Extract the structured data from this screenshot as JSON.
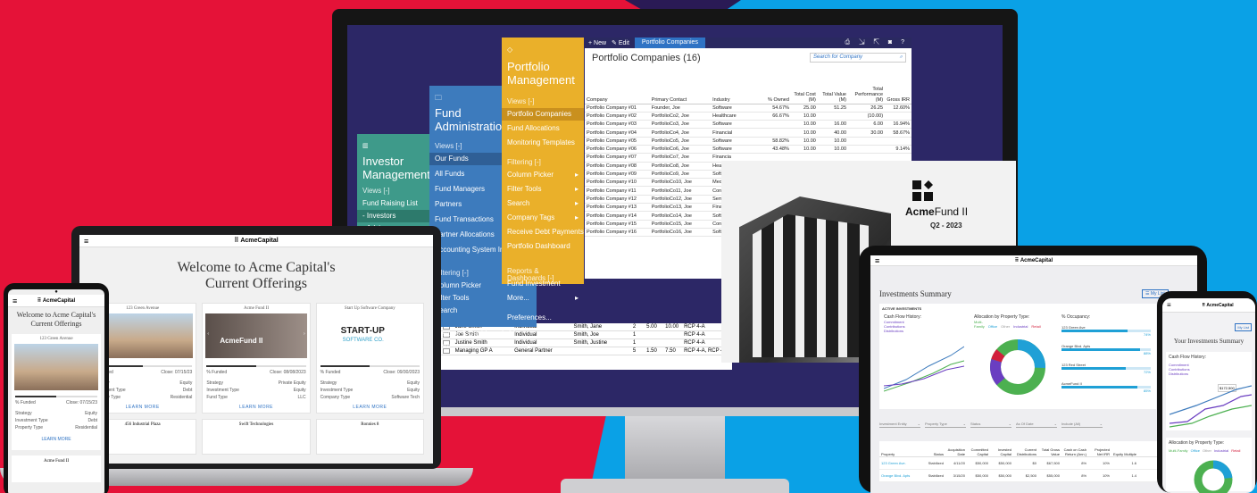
{
  "colors": {
    "red": "#e51238",
    "blue": "#0aa1e6",
    "navy": "#2c2766",
    "yellow": "#eab02a",
    "steel": "#3d7bbd",
    "teal": "#3e9a8a"
  },
  "investor": {
    "title": "Investor Management",
    "views": "Views [-]",
    "items": [
      "Fund Raising List",
      "- Investors",
      "- Advisors"
    ]
  },
  "fund": {
    "title": "Fund Administration",
    "views": "Views [-]",
    "items": [
      "Our Funds",
      "All Funds",
      "Fund Managers",
      "Partners",
      "Fund Transactions",
      "Partner Allocations",
      "Accounting System Interface"
    ],
    "filtering": "Filtering [-]",
    "filters": [
      "Column Picker",
      "Filter Tools",
      "Search"
    ],
    "reports": "Reports & Dashboards [-]",
    "more": "More...",
    "prefs": "Preferences..."
  },
  "portfolio": {
    "title": "Portfolio Management",
    "views": "Views [-]",
    "items": [
      "Portfolio Companies",
      "Fund Allocations",
      "Monitoring Templates"
    ],
    "filtering": "Filtering [-]",
    "filters": [
      "Column Picker",
      "Filter Tools",
      "Search",
      "Company Tags",
      "Receive Debt Payments",
      "Portfolio Dashboard"
    ],
    "reports": "Reports & Dashboards [-]",
    "reports_items": [
      "Fund Investment",
      "More..."
    ],
    "prefs": "Preferences..."
  },
  "toolbar": {
    "new": "+ New",
    "edit": "✎ Edit",
    "crumb": "Portfolio Companies",
    "icons": "⎙ ⇲ ⇱ ◙ ?"
  },
  "table": {
    "title": "Portfolio Companies (16)",
    "search_placeholder": "Search for Company",
    "headers": [
      "Company",
      "Primary Contact",
      "Industry",
      "% Owned",
      "Total Cost (M)",
      "Total Value (M)",
      "Total Performance (M)",
      "Gross IRR"
    ],
    "rows": [
      [
        "Portfolio Company #01",
        "Founder, Joe",
        "Software",
        "54.67%",
        "25.00",
        "51.25",
        "26.25",
        "12.60%"
      ],
      [
        "Portfolio Company #02",
        "PortfolioCo2, Joe",
        "Healthcare",
        "66.67%",
        "10.00",
        "",
        "(10.00)",
        ""
      ],
      [
        "Portfolio Company #03",
        "PortfolioCo3, Joe",
        "Software",
        "",
        "10.00",
        "16.00",
        "6.00",
        "16.94%"
      ],
      [
        "Portfolio Company #04",
        "PortfolioCo4, Joe",
        "Financial",
        "",
        "10.00",
        "40.00",
        "30.00",
        "58.67%"
      ],
      [
        "Portfolio Company #05",
        "PortfolioCo5, Joe",
        "Software",
        "58.82%",
        "10.00",
        "10.00",
        "",
        ""
      ],
      [
        "Portfolio Company #06",
        "PortfolioCo6, Joe",
        "Software",
        "43.48%",
        "10.00",
        "10.00",
        "",
        "9.14%"
      ],
      [
        "Portfolio Company #07",
        "PortfolioCo7, Joe",
        "Financia",
        "",
        "",
        "",
        "",
        ""
      ],
      [
        "Portfolio Company #08",
        "PortfolioCo8, Joe",
        "Healthc",
        "",
        "",
        "",
        "",
        ""
      ],
      [
        "Portfolio Company #09",
        "PortfolioCo9, Joe",
        "Softwa",
        "",
        "",
        "",
        "",
        ""
      ],
      [
        "Portfolio Company #10",
        "PortfolioCo10, Joe",
        "Medica",
        "",
        "",
        "",
        "",
        ""
      ],
      [
        "Portfolio Company #11",
        "PortfolioCo11, Joe",
        "Consu",
        "",
        "",
        "",
        "",
        ""
      ],
      [
        "Portfolio Company #12",
        "PortfolioCo12, Joe",
        "Semico",
        "",
        "",
        "",
        "",
        ""
      ],
      [
        "Portfolio Company #13",
        "PortfolioCo13, Joe",
        "Financi",
        "",
        "",
        "",
        "",
        ""
      ],
      [
        "Portfolio Company #14",
        "PortfolioCo14, Joe",
        "Softwa",
        "",
        "",
        "",
        "",
        ""
      ],
      [
        "Portfolio Company #15",
        "PortfolioCo15, Joe",
        "Consu",
        "",
        "",
        "",
        "",
        ""
      ],
      [
        "Portfolio Company #16",
        "PortfolioCo16, Joe",
        "Softwa",
        "",
        "",
        "",
        "",
        ""
      ]
    ]
  },
  "lower": [
    [
      "Jane Smith",
      "Individual",
      "Smith, Jane",
      "2",
      "5.00",
      "10.00",
      "RCP 4-A"
    ],
    [
      "Joe Smith",
      "Individual",
      "Smith, Joe",
      "1",
      "",
      "",
      "RCP 4-A"
    ],
    [
      "Justine Smith",
      "Individual",
      "Smith, Justine",
      "1",
      "",
      "",
      "RCP 4-A"
    ],
    [
      "Managing GP A",
      "General Partner",
      "",
      "5",
      "1.50",
      "7.50",
      "RCP 4-A, RCP 4-..."
    ]
  ],
  "cover": {
    "brand_bold": "Acme",
    "brand": "Fund II",
    "quarter": "Q2 - 2023"
  },
  "laptop": {
    "logo": "⠿ AcmeCapital",
    "welcome": "Welcome to Acme Capital's Current Offerings",
    "cards": [
      {
        "title": "123 Green Avenue",
        "funded": "% Funded",
        "close": "Close: 07/15/23",
        "l1": "Strategy",
        "v1": "Equity",
        "l2": "Investment Type",
        "v2": "Debt",
        "l3": "Property Type",
        "v3": "Residential"
      },
      {
        "title": "Acme Fund II",
        "funded": "% Funded",
        "close": "Close: 08/08/2023",
        "l1": "Strategy",
        "v1": "Private Equity",
        "l2": "Investment Type",
        "v2": "Equity",
        "l3": "Fund Type",
        "v3": "LLC"
      },
      {
        "title": "Start Up Software Company",
        "funded": "% Funded",
        "close": "Close: 09/30/2023",
        "l1": "Strategy",
        "v1": "Equity",
        "l2": "Investment Type",
        "v2": "Equity",
        "l3": "Company Type",
        "v3": "Software Tech"
      }
    ],
    "learn": "LEARN MORE",
    "fund_logo": "AcmeFund II",
    "startup": "START-UP",
    "startup_sub": "SOFTWARE CO.",
    "cards2": [
      "456 Industrial Plaza",
      "Swift Technologies",
      "Ronnies 8"
    ]
  },
  "phone": {
    "logo": "⠿ AcmeCapital",
    "welcome": "Welcome to Acme Capital's Current Offerings",
    "card": "123 Green Avenue",
    "funded": "% Funded",
    "close": "Close: 07/15/23",
    "rows": [
      [
        "Strategy",
        "Equity"
      ],
      [
        "Investment Type",
        "Debt"
      ],
      [
        "Property Type",
        "Residential"
      ]
    ],
    "learn": "LEARN MORE",
    "next": "Acme Fund II"
  },
  "tablet": {
    "logo": "⠿ AcmeCapital",
    "title": "Investments Summary",
    "mylist": "My List",
    "section": "ACTIVE INVESTMENTS",
    "cash": "Cash Flow History:",
    "legend": [
      "Commitment",
      "Contributions",
      "Distributions"
    ],
    "alloc": "Allocation by Property Type:",
    "alloc_legend": [
      "Multi-Family",
      "Office",
      "Other",
      "Industrial",
      "Retail"
    ],
    "occupancy": "% Occupancy:",
    "occ": [
      [
        "123 Green Ave",
        "74%"
      ],
      [
        "Orange Blvd. Apts",
        "88%"
      ],
      [
        "123 Red Street",
        "72%"
      ],
      [
        "AcmeFund II",
        "85%"
      ]
    ],
    "filters": [
      "Investment Entity",
      "Property Type",
      "Status",
      "As Of Date",
      "Include (All)"
    ],
    "cols": [
      "Property",
      "Status",
      "Acquisition Date",
      "Committed Capital",
      "Invested Capital",
      "Current Distributions",
      "Total Gross Value",
      "Cash on Cash Return (Ann.)",
      "Projected Net IRR",
      "Equity Multiple"
    ],
    "rows": [
      [
        "123 Green Ave.",
        "Stabilized",
        "4/11/20",
        "$50,000",
        "$50,000",
        "$0",
        "$67,500",
        "8%",
        "10%",
        "1.6"
      ],
      [
        "Orange Blvd. Apts",
        "Stabilized",
        "3/15/20",
        "$50,000",
        "$50,000",
        "$2,500",
        "$55,000",
        "8%",
        "10%",
        "1.4"
      ]
    ]
  },
  "phone2": {
    "logo": "⠿ AcmeCapital",
    "title": "Your Investments Summary",
    "cash": "Cash Flow History:",
    "legend": [
      "Commitment",
      "Contributions",
      "Distributions"
    ],
    "alloc": "Allocation by Property Type:",
    "alloc_legend": [
      "Multi-Family",
      "Office",
      "Other",
      "Industrial",
      "Retail"
    ],
    "amount": "$172,500",
    "mylist": "My List"
  }
}
